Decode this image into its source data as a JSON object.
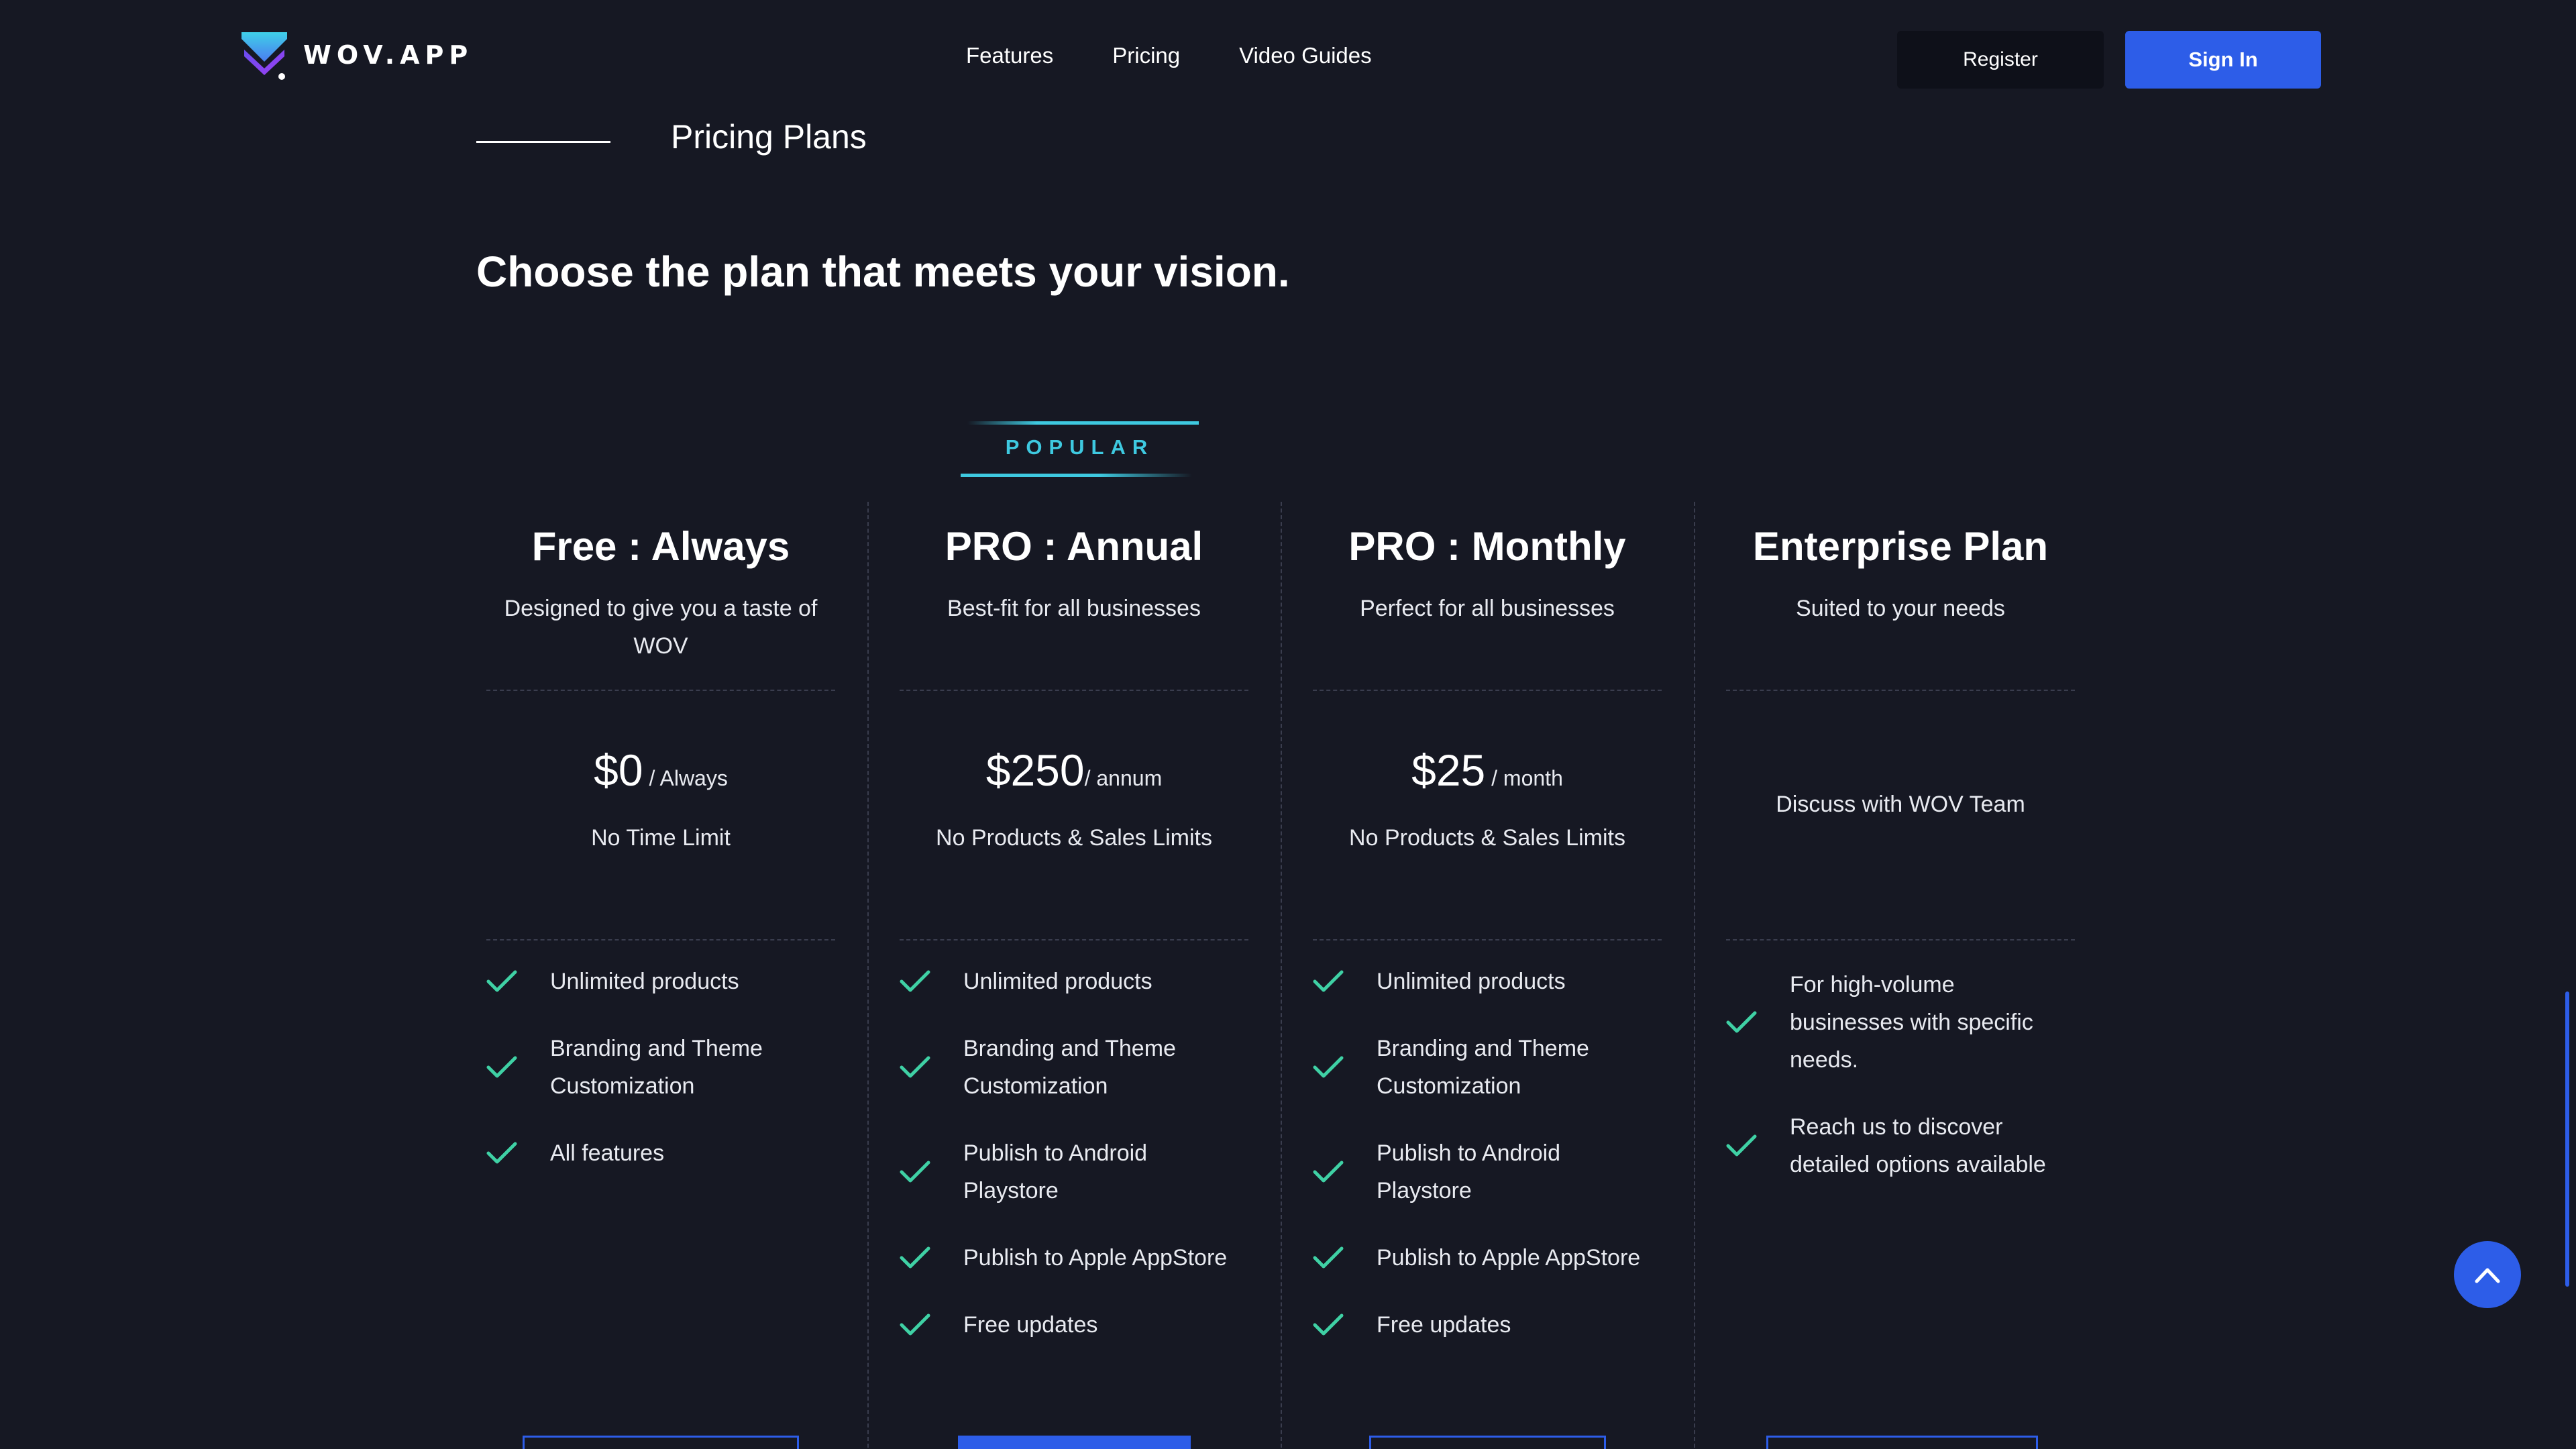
{
  "header": {
    "logo_text": "WOV.APP",
    "nav": [
      "Features",
      "Pricing",
      "Video Guides"
    ],
    "register_label": "Register",
    "signin_label": "Sign In"
  },
  "section": {
    "eyebrow": "Pricing Plans",
    "headline": "Choose the plan that meets your vision.",
    "popular_badge": "POPULAR"
  },
  "plans": [
    {
      "name": "Free : Always",
      "subtitle": "Designed to give you a taste of WOV",
      "price": "$0",
      "period": " / Always",
      "note": "No Time Limit",
      "features": [
        "Unlimited products",
        "Branding and Theme Customization",
        "All features"
      ]
    },
    {
      "name": "PRO : Annual",
      "subtitle": "Best-fit for all businesses",
      "price": "$250",
      "period": "/ annum",
      "note": "No Products & Sales Limits",
      "features": [
        "Unlimited products",
        "Branding and Theme Customization",
        "Publish to Android Playstore",
        "Publish to Apple AppStore",
        "Free updates"
      ]
    },
    {
      "name": "PRO : Monthly",
      "subtitle": "Perfect for all businesses",
      "price": "$25",
      "period": " / month",
      "note": "No Products & Sales Limits",
      "features": [
        "Unlimited products",
        "Branding and Theme Customization",
        "Publish to Android Playstore",
        "Publish to Apple AppStore",
        "Free updates"
      ]
    },
    {
      "name": "Enterprise Plan",
      "subtitle": "Suited to your needs",
      "discuss": "Discuss with WOV Team",
      "features": [
        "For high-volume businesses with specific needs.",
        "Reach us to discover detailed options available"
      ]
    }
  ],
  "icons": {
    "check": "check-icon",
    "scroll_top": "chevron-up-icon"
  },
  "colors": {
    "background": "#161823",
    "accent": "#2d5de8",
    "check": "#3fd1a5",
    "popular": "#3ec9e0"
  }
}
